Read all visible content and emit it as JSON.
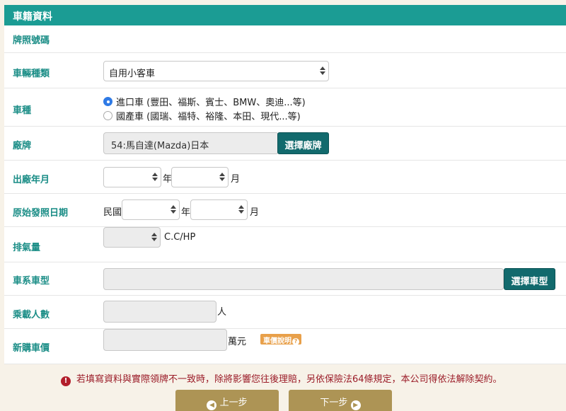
{
  "section": {
    "title": "車籍資料"
  },
  "fields": {
    "plate": {
      "label": "牌照號碼"
    },
    "vehicle_type": {
      "label": "車輛種類",
      "selected": "自用小客車"
    },
    "car_kind": {
      "label": "車種",
      "options": [
        {
          "label": "進口車 (豐田、福斯、賓士、BMW、奧迪...等)",
          "checked": true
        },
        {
          "label": "國產車 (國瑞、福特、裕隆、本田、現代...等)",
          "checked": false
        }
      ]
    },
    "brand": {
      "label": "廠牌",
      "value": "54:馬自達(Mazda)日本",
      "button": "選擇廠牌"
    },
    "manufacture_date": {
      "label": "出廠年月",
      "year_suffix": "年",
      "month_suffix": "月"
    },
    "first_reg_date": {
      "label": "原始發照日期",
      "prefix": "民國",
      "year_suffix": "年",
      "month_suffix": "月"
    },
    "displacement": {
      "label": "排氣量",
      "unit": "C.C/HP"
    },
    "model": {
      "label": "車系車型",
      "button": "選擇車型"
    },
    "seats": {
      "label": "乘載人數",
      "unit": "人"
    },
    "price": {
      "label": "新購車價",
      "unit": "萬元",
      "help_badge": "車價說明"
    }
  },
  "warning": {
    "icon": "!",
    "text": "若填寫資料與實際領牌不一致時，除將影響您往後理賠，另依保險法64條規定，本公司得依法解除契約。"
  },
  "nav": {
    "prev": "上一步",
    "next": "下一步"
  },
  "colors": {
    "header": "#1b9c94",
    "label": "#1a8d86",
    "teal_button": "#126a6d",
    "gold_button": "#ad9455",
    "warning": "#9b1c28",
    "badge": "#e8a04a"
  }
}
